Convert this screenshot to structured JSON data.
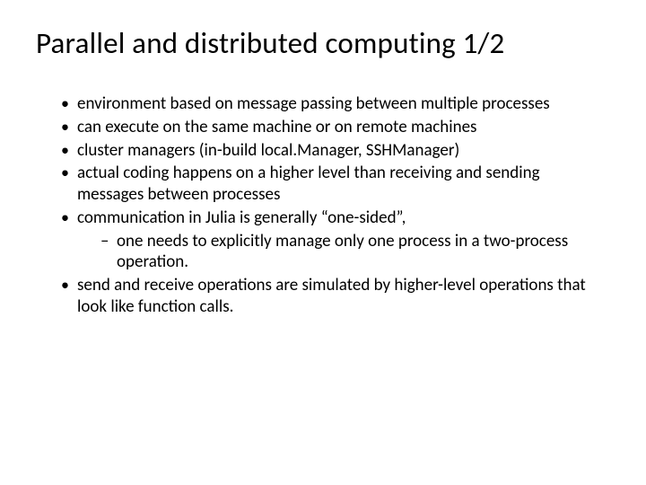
{
  "slide": {
    "title": "Parallel and distributed computing 1/2",
    "bullets": [
      {
        "text": "environment based on message passing between multiple processes"
      },
      {
        "text": "can execute on the same machine or on remote machines"
      },
      {
        "text": "cluster managers (in-build local.Manager, SSHManager)"
      },
      {
        "text": "actual coding happens on a higher level than receiving and sending messages between processes"
      },
      {
        "text": "communication in Julia is generally “one-sided”,",
        "sub": [
          "one needs to explicitly manage only one process in a two-process operation."
        ]
      },
      {
        "text": "send and receive operations are simulated by higher-level operations that look like function calls."
      }
    ]
  }
}
